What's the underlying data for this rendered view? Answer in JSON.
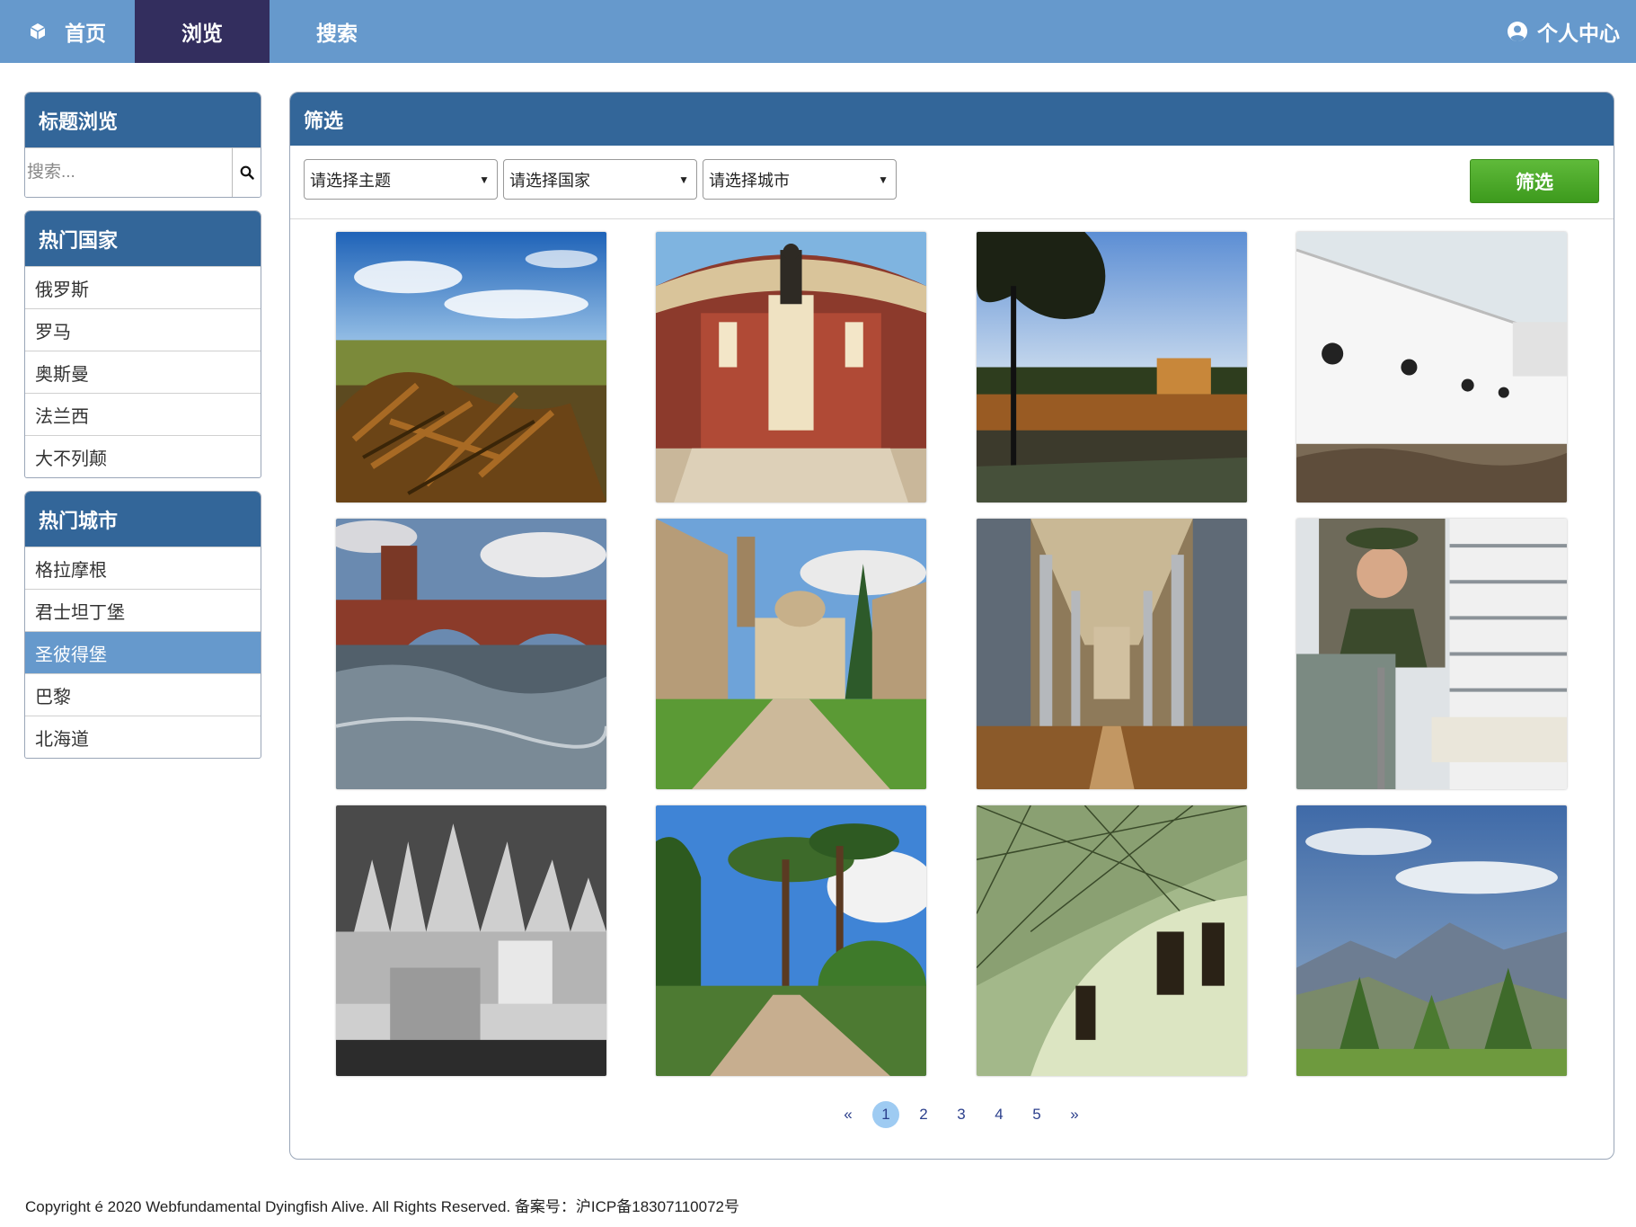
{
  "nav": {
    "home": "首页",
    "browse": "浏览",
    "search": "搜索",
    "profile": "个人中心"
  },
  "sidebar": {
    "title_browse": {
      "heading": "标题浏览",
      "placeholder": "搜索..."
    },
    "countries": {
      "heading": "热门国家",
      "items": [
        "俄罗斯",
        "罗马",
        "奥斯曼",
        "法兰西",
        "大不列颠"
      ]
    },
    "cities": {
      "heading": "热门城市",
      "items": [
        "格拉摩根",
        "君士坦丁堡",
        "圣彼得堡",
        "巴黎",
        "北海道"
      ],
      "selected": "圣彼得堡"
    }
  },
  "main": {
    "heading": "筛选",
    "filters": {
      "theme": "请选择主题",
      "country": "请选择国家",
      "city": "请选择城市",
      "button": "筛选"
    },
    "pagination": {
      "prev": "«",
      "pages": [
        "1",
        "2",
        "3",
        "4",
        "5"
      ],
      "current": "1",
      "next": "»"
    }
  },
  "footer": {
    "text": "Copyright é 2020 Webfundamental Dyingfish Alive. All Rights Reserved. 备案号：沪ICP备18307110072号"
  },
  "colors": {
    "nav_bg": "#6699cc",
    "nav_active": "#332e5e",
    "panel_header": "#336699",
    "filter_button": "#4caf2a",
    "selected_item": "#6699cc"
  }
}
